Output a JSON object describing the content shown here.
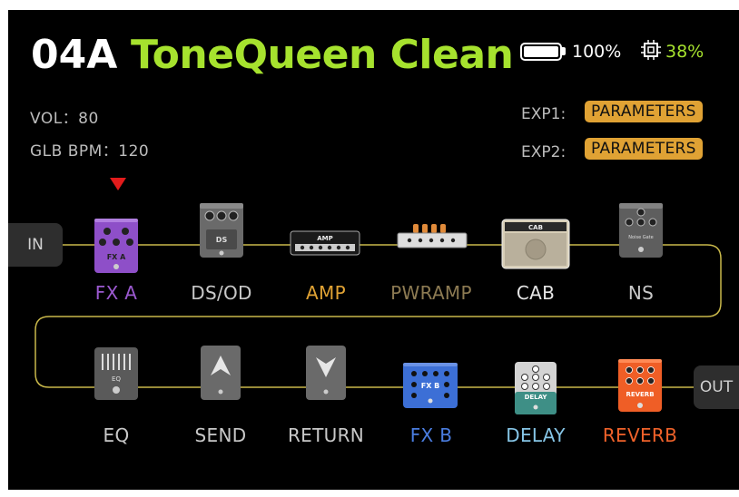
{
  "preset": {
    "number": "04A",
    "name": "ToneQueen Clean"
  },
  "status": {
    "battery": "100%",
    "cpu": "38%"
  },
  "info": {
    "vol": "VOL：80",
    "bpm": "GLB BPM：120"
  },
  "expression": [
    {
      "label": "EXP1:",
      "value": "PARAMETERS"
    },
    {
      "label": "EXP2:",
      "value": "PARAMETERS"
    }
  ],
  "io": {
    "in": "IN",
    "out": "OUT"
  },
  "chain": {
    "row1": [
      {
        "label": "FX A",
        "color": "#9b59d0",
        "icon": "fx-a-pedal-icon"
      },
      {
        "label": "DS/OD",
        "color": "#c8c8c8",
        "icon": "ds-od-pedal-icon"
      },
      {
        "label": "AMP",
        "color": "#e0a234",
        "icon": "amp-head-icon"
      },
      {
        "label": "PWRAMP",
        "color": "#8c7a52",
        "icon": "power-amp-icon"
      },
      {
        "label": "CAB",
        "color": "#e6e6e6",
        "icon": "cabinet-icon"
      },
      {
        "label": "NS",
        "color": "#c8c8c8",
        "icon": "noise-suppressor-pedal-icon"
      }
    ],
    "row2": [
      {
        "label": "EQ",
        "color": "#c8c8c8",
        "icon": "eq-pedal-icon"
      },
      {
        "label": "SEND",
        "color": "#c8c8c8",
        "icon": "send-icon"
      },
      {
        "label": "RETURN",
        "color": "#c8c8c8",
        "icon": "return-icon"
      },
      {
        "label": "FX B",
        "color": "#4a7de0",
        "icon": "fx-b-pedal-icon"
      },
      {
        "label": "DELAY",
        "color": "#86c5e6",
        "icon": "delay-pedal-icon"
      },
      {
        "label": "REVERB",
        "color": "#f0622a",
        "icon": "reverb-pedal-icon"
      }
    ]
  },
  "pedal_text": {
    "fxa": "FX A",
    "ds": "DS",
    "amp": "AMP",
    "cab": "CAB",
    "ns": "Noise Gate",
    "eq": "EQ",
    "fxb": "FX B",
    "delay": "DELAY",
    "reverb": "REVERB"
  },
  "colors": {
    "accent_green": "#a6e22e",
    "chain_line": "#c9b84a",
    "exp_button": "#e0a234",
    "selected_marker": "#e21b1b"
  }
}
